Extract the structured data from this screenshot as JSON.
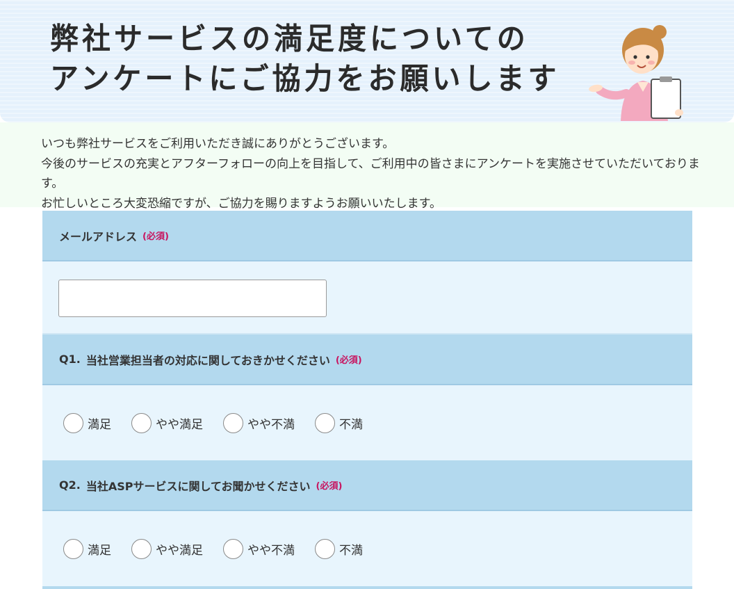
{
  "banner": {
    "title_line1": "弊社サービスの満足度についての",
    "title_line2": "アンケートにご協力をお願いします"
  },
  "intro": {
    "line1": "いつも弊社サービスをご利用いただき誠にありがとうございます。",
    "line2": "今後のサービスの充実とアフターフォローの向上を目指して、ご利用中の皆さまにアンケートを実施させていただいております。",
    "line3": "お忙しいところ大変恐縮ですが、ご協力を賜りますようお願いいたします。"
  },
  "form": {
    "required_label": "(必須)",
    "email": {
      "label": "メールアドレス",
      "value": "",
      "placeholder": ""
    },
    "q1": {
      "number": "Q1.",
      "text": "当社営業担当者の対応に関しておきかせください",
      "options": [
        "満足",
        "やや満足",
        "やや不満",
        "不満"
      ]
    },
    "q2": {
      "number": "Q2.",
      "text": "当社ASPサービスに関してお聞かせください",
      "options": [
        "満足",
        "やや満足",
        "やや不満",
        "不満"
      ]
    }
  },
  "colors": {
    "header_band": "#b3d9ee",
    "body_band": "#e8f5fd",
    "required": "#c8145f",
    "banner_bg": "#e5f1fc"
  },
  "icons": {
    "mascot": "woman-holding-clipboard-illustration"
  }
}
